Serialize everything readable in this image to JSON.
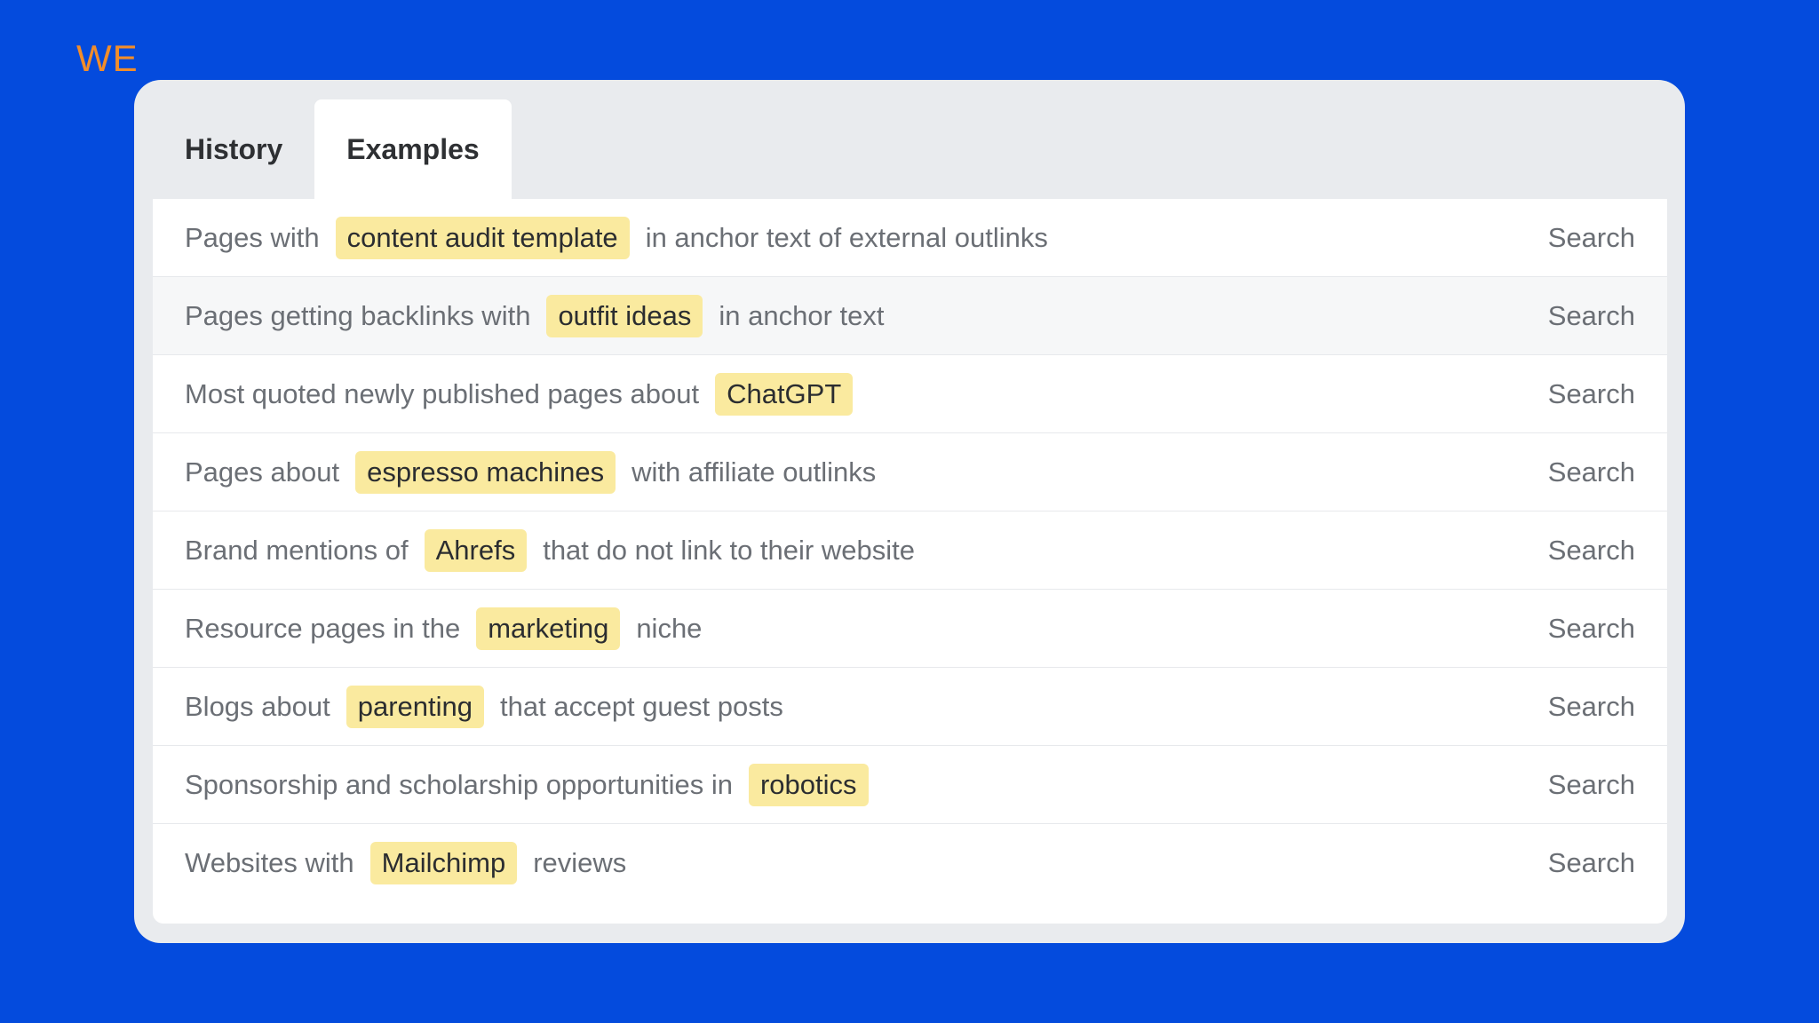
{
  "logo": {
    "text": "WE"
  },
  "tabs": [
    {
      "label": "History",
      "active": false
    },
    {
      "label": "Examples",
      "active": true
    }
  ],
  "examples": [
    {
      "before": "Pages with",
      "keyword": "content audit template",
      "after": "in anchor text of external outlinks",
      "action": "Search"
    },
    {
      "before": "Pages getting backlinks with",
      "keyword": "outfit ideas",
      "after": "in anchor text",
      "action": "Search"
    },
    {
      "before": "Most quoted newly published pages about",
      "keyword": "ChatGPT",
      "after": "",
      "action": "Search"
    },
    {
      "before": "Pages about",
      "keyword": "espresso machines",
      "after": "with affiliate outlinks",
      "action": "Search"
    },
    {
      "before": "Brand mentions of",
      "keyword": "Ahrefs",
      "after": "that do not link to their website",
      "action": "Search"
    },
    {
      "before": "Resource pages in the",
      "keyword": "marketing",
      "after": "niche",
      "action": "Search"
    },
    {
      "before": "Blogs about",
      "keyword": "parenting",
      "after": "that accept guest posts",
      "action": "Search"
    },
    {
      "before": "Sponsorship and scholarship opportunities in",
      "keyword": "robotics",
      "after": "",
      "action": "Search"
    },
    {
      "before": "Websites with",
      "keyword": "Mailchimp",
      "after": "reviews",
      "action": "Search"
    }
  ],
  "colors": {
    "background": "#044bdd",
    "logo": "#f28d2a",
    "highlight": "#faea9f"
  }
}
